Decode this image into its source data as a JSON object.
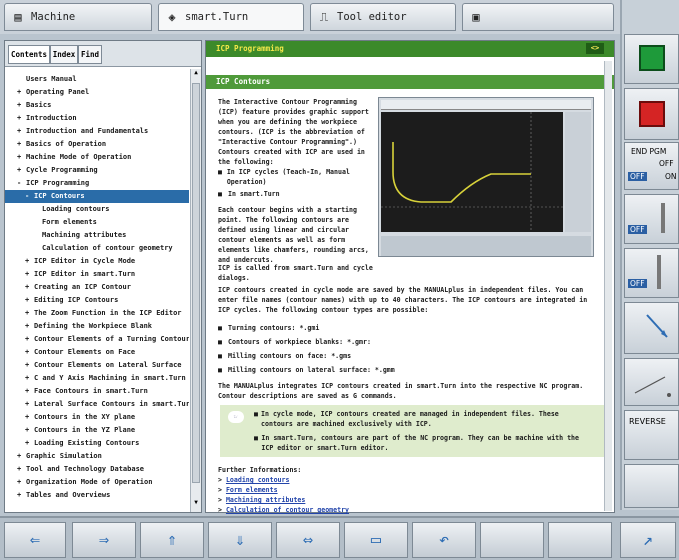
{
  "tabs": [
    {
      "label": "Machine",
      "icon": "machine-icon"
    },
    {
      "label": "smart.Turn",
      "icon": "diamond-arrow-icon"
    },
    {
      "label": "Tool editor",
      "icon": "tool-icon"
    },
    {
      "label": "",
      "icon": "save-icon"
    }
  ],
  "left_tabs": [
    "Contents",
    "Index",
    "Find"
  ],
  "tree": [
    {
      "label": "Users Manual",
      "indent": 0,
      "marker": ""
    },
    {
      "label": "Operating Panel",
      "indent": 0,
      "marker": "+"
    },
    {
      "label": "Basics",
      "indent": 0,
      "marker": "+"
    },
    {
      "label": "Introduction",
      "indent": 0,
      "marker": "+"
    },
    {
      "label": "Introduction and Fundamentals",
      "indent": 0,
      "marker": "+"
    },
    {
      "label": "Basics of Operation",
      "indent": 0,
      "marker": "+"
    },
    {
      "label": "Machine Mode of Operation",
      "indent": 0,
      "marker": "+"
    },
    {
      "label": "Cycle Programming",
      "indent": 0,
      "marker": "+"
    },
    {
      "label": "ICP Programming",
      "indent": 0,
      "marker": "-"
    },
    {
      "label": "ICP Contours",
      "indent": 1,
      "marker": "-",
      "selected": true
    },
    {
      "label": "Loading contours",
      "indent": 2,
      "marker": ""
    },
    {
      "label": "Form elements",
      "indent": 2,
      "marker": ""
    },
    {
      "label": "Machining attributes",
      "indent": 2,
      "marker": ""
    },
    {
      "label": "Calculation of contour geometry",
      "indent": 2,
      "marker": ""
    },
    {
      "label": "ICP Editor in Cycle Mode",
      "indent": 1,
      "marker": "+"
    },
    {
      "label": "ICP Editor in smart.Turn",
      "indent": 1,
      "marker": "+"
    },
    {
      "label": "Creating an ICP Contour",
      "indent": 1,
      "marker": "+"
    },
    {
      "label": "Editing ICP Contours",
      "indent": 1,
      "marker": "+"
    },
    {
      "label": "The Zoom Function in the ICP Editor",
      "indent": 1,
      "marker": "+"
    },
    {
      "label": "Defining the Workpiece Blank",
      "indent": 1,
      "marker": "+"
    },
    {
      "label": "Contour Elements of a Turning Contour",
      "indent": 1,
      "marker": "+"
    },
    {
      "label": "Contour Elements on Face",
      "indent": 1,
      "marker": "+"
    },
    {
      "label": "Contour Elements on Lateral Surface",
      "indent": 1,
      "marker": "+"
    },
    {
      "label": "C and Y Axis Machining in smart.Turn",
      "indent": 1,
      "marker": "+"
    },
    {
      "label": "Face Contours in smart.Turn",
      "indent": 1,
      "marker": "+"
    },
    {
      "label": "Lateral Surface Contours in smart.Turn",
      "indent": 1,
      "marker": "+"
    },
    {
      "label": "Contours in the XY plane",
      "indent": 1,
      "marker": "+"
    },
    {
      "label": "Contours in the YZ Plane",
      "indent": 1,
      "marker": "+"
    },
    {
      "label": "Loading Existing Contours",
      "indent": 1,
      "marker": "+"
    },
    {
      "label": "Graphic Simulation",
      "indent": 0,
      "marker": "+"
    },
    {
      "label": "Tool and Technology Database",
      "indent": 0,
      "marker": "+"
    },
    {
      "label": "Organization Mode of Operation",
      "indent": 0,
      "marker": "+"
    },
    {
      "label": "Tables and Overviews",
      "indent": 0,
      "marker": "+"
    }
  ],
  "doc": {
    "header": "ICP Programming",
    "nav_label": "<>",
    "subheader": "ICP Contours",
    "intro": "The Interactive Contour Programming (ICP) feature provides graphic support when you are defining the workpiece contours. (ICP is the abbreviation of \"Interactive Contour Programming\".) Contours created with ICP are used in the following:",
    "bullets1": [
      "In ICP cycles (Teach-In, Manual Operation)",
      "In smart.Turn"
    ],
    "para2": "Each contour begins with a starting point. The following contours are defined using linear and circular contour elements as well as form elements like chamfers, rounding arcs, and undercuts.",
    "para3": "ICP is called from smart.Turn and cycle dialogs.",
    "para4": "ICP contours created in cycle mode are saved by the MANUALplus in independent files. You can enter file names (contour names) with up to 40 characters. The ICP contours are integrated in ICP cycles. The following contour types are possible:",
    "bullets2": [
      "Turning contours: *.gmi",
      "Contours of workpiece blanks: *.gmr:",
      "Milling contours on face: *.gms",
      "Milling contours on lateral surface: *.gmm"
    ],
    "para5": "The MANUALplus integrates ICP contours created in smart.Turn into the respective NC program. Contour descriptions are saved as G commands.",
    "notes": [
      "In cycle mode, ICP contours created are managed in independent files. These contours are machined exclusively with ICP.",
      "In smart.Turn, contours are part of the NC program. They can be machine with the ICP editor or smart.Turn editor."
    ],
    "further_title": "Further Informations:",
    "links": [
      "Loading contours",
      "Form elements",
      "Machining attributes",
      "Calculation of contour geometry"
    ]
  },
  "sidebar": {
    "end_pgm": "END PGM",
    "off": "OFF",
    "on": "ON",
    "reverse": "REVERSE"
  }
}
